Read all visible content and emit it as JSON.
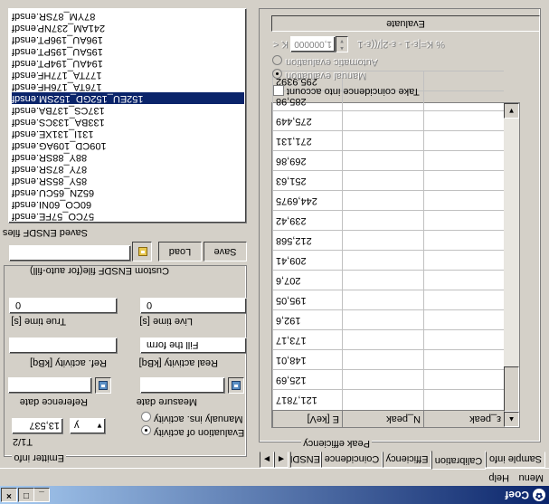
{
  "window": {
    "title": "Coef",
    "minimize": "_",
    "maximize": "□",
    "close": "×"
  },
  "menu": {
    "items": [
      "Menu",
      "Help"
    ]
  },
  "emitter": {
    "group_label": "Emitter info",
    "t12_label": "T1/2",
    "t12_value": "13,537",
    "unit_value": "y",
    "radio_eval": "Evaluation of activity",
    "radio_manual": "Manualy ins. activity",
    "reference_date_label": "Reference date",
    "measure_date_label": "Measure date",
    "ref_activity_label": "Ref. activity [kBq]",
    "real_activity_label": "Real activity [kBq]",
    "real_activity_value": "Fill the form",
    "true_time_label": "True time [s]",
    "true_time_value": "0",
    "live_time_label": "Live time [s]",
    "live_time_value": "0"
  },
  "ensdf": {
    "custom_label": "Custom ENSDF file(for auto-fill)",
    "load_button": "Load",
    "save_button": "Save",
    "saved_label": "Saved ENSDF files",
    "files": [
      "57CO_57FE.ensdf",
      "60CO_60NI.ensdf",
      "65ZN_65CU.ensdf",
      "85Y_85SR.ensdf",
      "87Y_87SR.ensdf",
      "88Y_88SR.ensdf",
      "109CD_109AG.ensdf",
      "131I_131XE.ensdf",
      "133BA_133CS.ensdf",
      "137CS_137BA.ensdf",
      "152EU_152GD_152SM.ensdf",
      "176TA_176HF.ensdf",
      "177TA_177HF.ensdf",
      "194AU_194PT.ensdf",
      "195AU_195PT.ensdf",
      "196AU_196PT.ensdf",
      "241AM_237NP.ensdf",
      "87YM_87SR.ensdf"
    ],
    "selected_index": 10
  },
  "evaluate": {
    "button": "Evaluate",
    "k_prefix": "K <",
    "k_value": "1,000000",
    "formula": "% K=|ε-1 - ε-2|/((ε-1",
    "radio_auto": "Automatic evaluation",
    "radio_manual": "Manual evaluation",
    "coincidence_check": "Take coincidence into account"
  },
  "peak_efficiency": {
    "group_label": "Peak efficiency",
    "columns": [
      "E [keV]",
      "N_peak",
      "ε_peak"
    ],
    "rows": [
      "121,7817",
      "125,69",
      "148,01",
      "173,17",
      "192,6",
      "195,05",
      "207,6",
      "209,41",
      "212,568",
      "239,42",
      "244,6975",
      "251,63",
      "269,86",
      "271,131",
      "275,449",
      "285,98",
      "295,9392"
    ]
  },
  "tabs": [
    "Sample info",
    "Calibration",
    "Efficiency",
    "Coincidence",
    "ENSDF"
  ],
  "active_tab": 1
}
